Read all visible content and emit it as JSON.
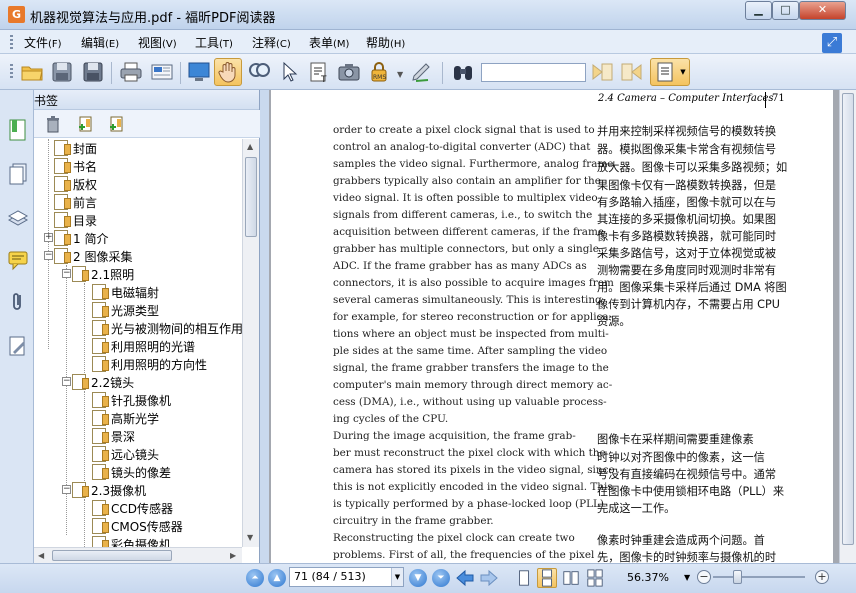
{
  "window": {
    "title": "机器视觉算法与应用.pdf - 福昕PDF阅读器"
  },
  "menu": [
    {
      "label": "文件",
      "key": "(F)"
    },
    {
      "label": "编辑",
      "key": "(E)"
    },
    {
      "label": "视图",
      "key": "(V)"
    },
    {
      "label": "工具",
      "key": "(T)"
    },
    {
      "label": "注释",
      "key": "(C)"
    },
    {
      "label": "表单",
      "key": "(M)"
    },
    {
      "label": "帮助",
      "key": "(H)"
    }
  ],
  "bookmarks": {
    "title": "书签",
    "items": [
      {
        "label": "封面"
      },
      {
        "label": "书名"
      },
      {
        "label": "版权"
      },
      {
        "label": "前言"
      },
      {
        "label": "目录"
      },
      {
        "label": "1  简介"
      },
      {
        "label": "2  图像采集"
      },
      {
        "label": "2.1照明"
      },
      {
        "label": "电磁辐射"
      },
      {
        "label": "光源类型"
      },
      {
        "label": "光与被测物间的相互作用"
      },
      {
        "label": "利用照明的光谱"
      },
      {
        "label": "利用照明的方向性"
      },
      {
        "label": "2.2镜头"
      },
      {
        "label": "针孔摄像机"
      },
      {
        "label": "高斯光学"
      },
      {
        "label": "景深"
      },
      {
        "label": "远心镜头"
      },
      {
        "label": "镜头的像差"
      },
      {
        "label": "2.3摄像机"
      },
      {
        "label": "CCD传感器"
      },
      {
        "label": "CMOS传感器"
      },
      {
        "label": "彩色摄像机"
      }
    ]
  },
  "page": {
    "header": "2.4  Camera – Computer Interfaces",
    "number": "71",
    "english": [
      "order to create a pixel clock signal that is used to",
      "control an analog-to-digital converter (ADC) that",
      "samples the video signal. Furthermore, analog frame",
      "grabbers typically also contain an amplifier for the",
      "video signal. It is often possible to multiplex video",
      "signals from different cameras, i.e., to switch the",
      "acquisition between different cameras, if the frame",
      "grabber has multiple connectors, but only a single",
      "ADC.  If the frame grabber has as many ADCs as",
      "connectors, it is also possible to acquire images from",
      "several cameras simultaneously.  This is interesting,",
      "for example, for stereo reconstruction or for applica-",
      "tions where an object must be inspected from multi-",
      "ple sides at the same time. After sampling the video",
      "signal, the frame grabber transfers the image to the",
      "computer's main memory through direct memory ac-",
      "cess (DMA), i.e., without using up valuable process-",
      "ing cycles of the CPU.",
      "    During the image acquisition, the frame grab-",
      "ber must reconstruct the pixel clock with which the",
      "camera has stored its pixels in the video signal, since",
      "this is not explicitly encoded in the video signal.  This",
      "is typically performed by a phase-locked loop (PLL)",
      "circuitry in the frame grabber.",
      "    Reconstructing the pixel clock can create two",
      "problems.  First of all, the frequencies of the pixel"
    ],
    "chinese": [
      "并用来控制采样视频信号的模数转换",
      "器。模拟图像采集卡常含有视频信号",
      "放大器。图像卡可以采集多路视频；如",
      "果图像卡仅有一路模数转换器，但是",
      "有多路输入插座，图像卡就可以在与",
      "其连接的多采摄像机间切换。如果图",
      "像卡有多路模数转换器，就可能同时",
      "采集多路信号，这对于立体视觉或被",
      "测物需要在多角度同时观测时非常有",
      "用。图像采集卡采样后通过 DMA 将图",
      "像传到计算机内存，不需要占用 CPU",
      "资源。",
      "    图像卡在采样期间需要重建像素",
      "时钟以对齐图像中的像素，这一信",
      "号没有直接编码在视频信号中。通常",
      "在图像卡中使用锁相环电路（PLL）来",
      "完成这一工作。",
      "    像素时钟重建会造成两个问题。首",
      "先，图像卡的时钟频率与摄像机的时"
    ]
  },
  "status": {
    "page_field": "71 (84 / 513)",
    "zoom": "56.37%"
  },
  "icons": {
    "page": "bookmark-page-icon",
    "accent": "#2f77cf"
  }
}
